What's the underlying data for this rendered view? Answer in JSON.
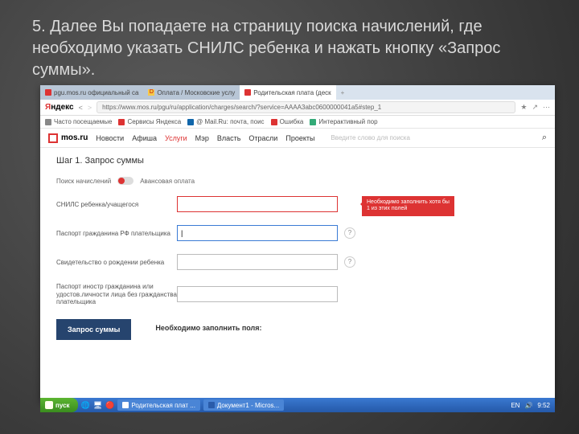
{
  "caption": "5. Далее Вы попадаете на страницу поиска начислений, где необходимо указать СНИЛС ребенка и нажать кнопку «Запрос суммы».",
  "tabs": [
    {
      "label": "pgu.mos.ru официальный са",
      "active": false
    },
    {
      "label": "Оплата / Московские услу",
      "active": false
    },
    {
      "label": "Родительская плата (деск",
      "active": true
    }
  ],
  "addressbar": {
    "yandex": "Яндекс",
    "url": "https://www.mos.ru/pgu/ru/application/charges/search/?service=AAAA3abc0600000041a5#step_1",
    "icons": [
      "★",
      "↗",
      "⋯"
    ]
  },
  "bookmarks": [
    {
      "label": "Часто посещаемые",
      "color": "#888"
    },
    {
      "label": "Сервисы Яндекса",
      "color": "#d33"
    },
    {
      "label": "@ Mail.Ru: почта, поис",
      "color": "#16a"
    },
    {
      "label": "Ошибка",
      "color": "#d33"
    },
    {
      "label": "Интерактивный пор",
      "color": "#3a7"
    }
  ],
  "site": {
    "logo": "mos.ru",
    "nav": [
      "Новости",
      "Афиша",
      "Услуги",
      "Мэр",
      "Власть",
      "Отрасли",
      "Проекты"
    ],
    "nav_active_index": 2,
    "search_placeholder": "Введите слово для поиска"
  },
  "form": {
    "step_title": "Шаг 1. Запрос суммы",
    "toggle_left": "Поиск начислений",
    "toggle_right": "Авансовая оплата",
    "rows": [
      {
        "label": "СНИЛС ребенка/учащегося",
        "state": "error"
      },
      {
        "label": "Паспорт гражданина РФ плательщика",
        "state": "focus",
        "help": true
      },
      {
        "label": "Свидетельство о рождении ребенка",
        "state": "normal",
        "help": true
      },
      {
        "label": "Паспорт иностр гражданина или удостов.личности лица без гражданства плательщика",
        "state": "normal"
      }
    ],
    "error_tip": "Необходимо заполнить хотя бы 1 из этих полей",
    "submit": "Запрос суммы",
    "required_note": "Необходимо заполнить поля:"
  },
  "taskbar": {
    "start": "пуск",
    "items": [
      "Родительская плат ...",
      "Документ1 - Micros..."
    ],
    "tray_lang": "EN",
    "tray_time": "9:52"
  }
}
